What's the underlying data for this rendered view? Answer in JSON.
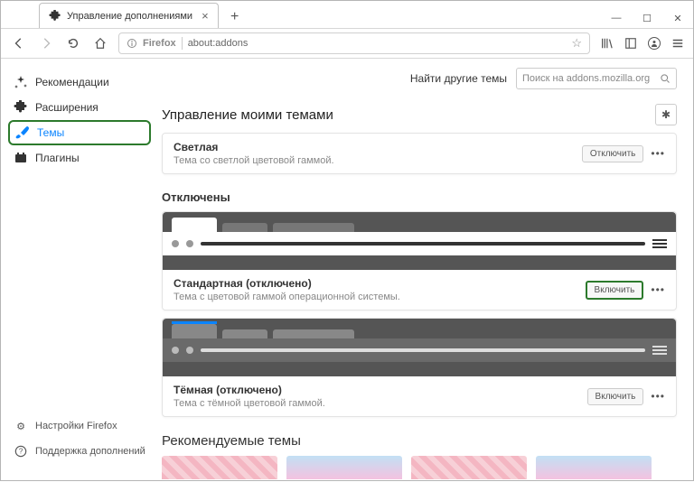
{
  "window": {
    "tab_title": "Управление дополнениями"
  },
  "urlbar": {
    "identity": "Firefox",
    "url": "about:addons"
  },
  "sidebar": {
    "items": [
      {
        "label": "Рекомендации"
      },
      {
        "label": "Расширения"
      },
      {
        "label": "Темы"
      },
      {
        "label": "Плагины"
      }
    ],
    "bottom": [
      {
        "label": "Настройки Firefox"
      },
      {
        "label": "Поддержка дополнений"
      }
    ]
  },
  "search": {
    "label": "Найти другие темы",
    "placeholder": "Поиск на addons.mozilla.org"
  },
  "heading": "Управление моими темами",
  "enabled": {
    "name": "Светлая",
    "desc": "Тема со светлой цветовой гаммой.",
    "action": "Отключить"
  },
  "disabled_heading": "Отключены",
  "themes": [
    {
      "name": "Стандартная (отключено)",
      "desc": "Тема с цветовой гаммой операционной системы.",
      "action": "Включить"
    },
    {
      "name": "Тёмная (отключено)",
      "desc": "Тема с тёмной цветовой гаммой.",
      "action": "Включить"
    }
  ],
  "recommended_heading": "Рекомендуемые темы"
}
